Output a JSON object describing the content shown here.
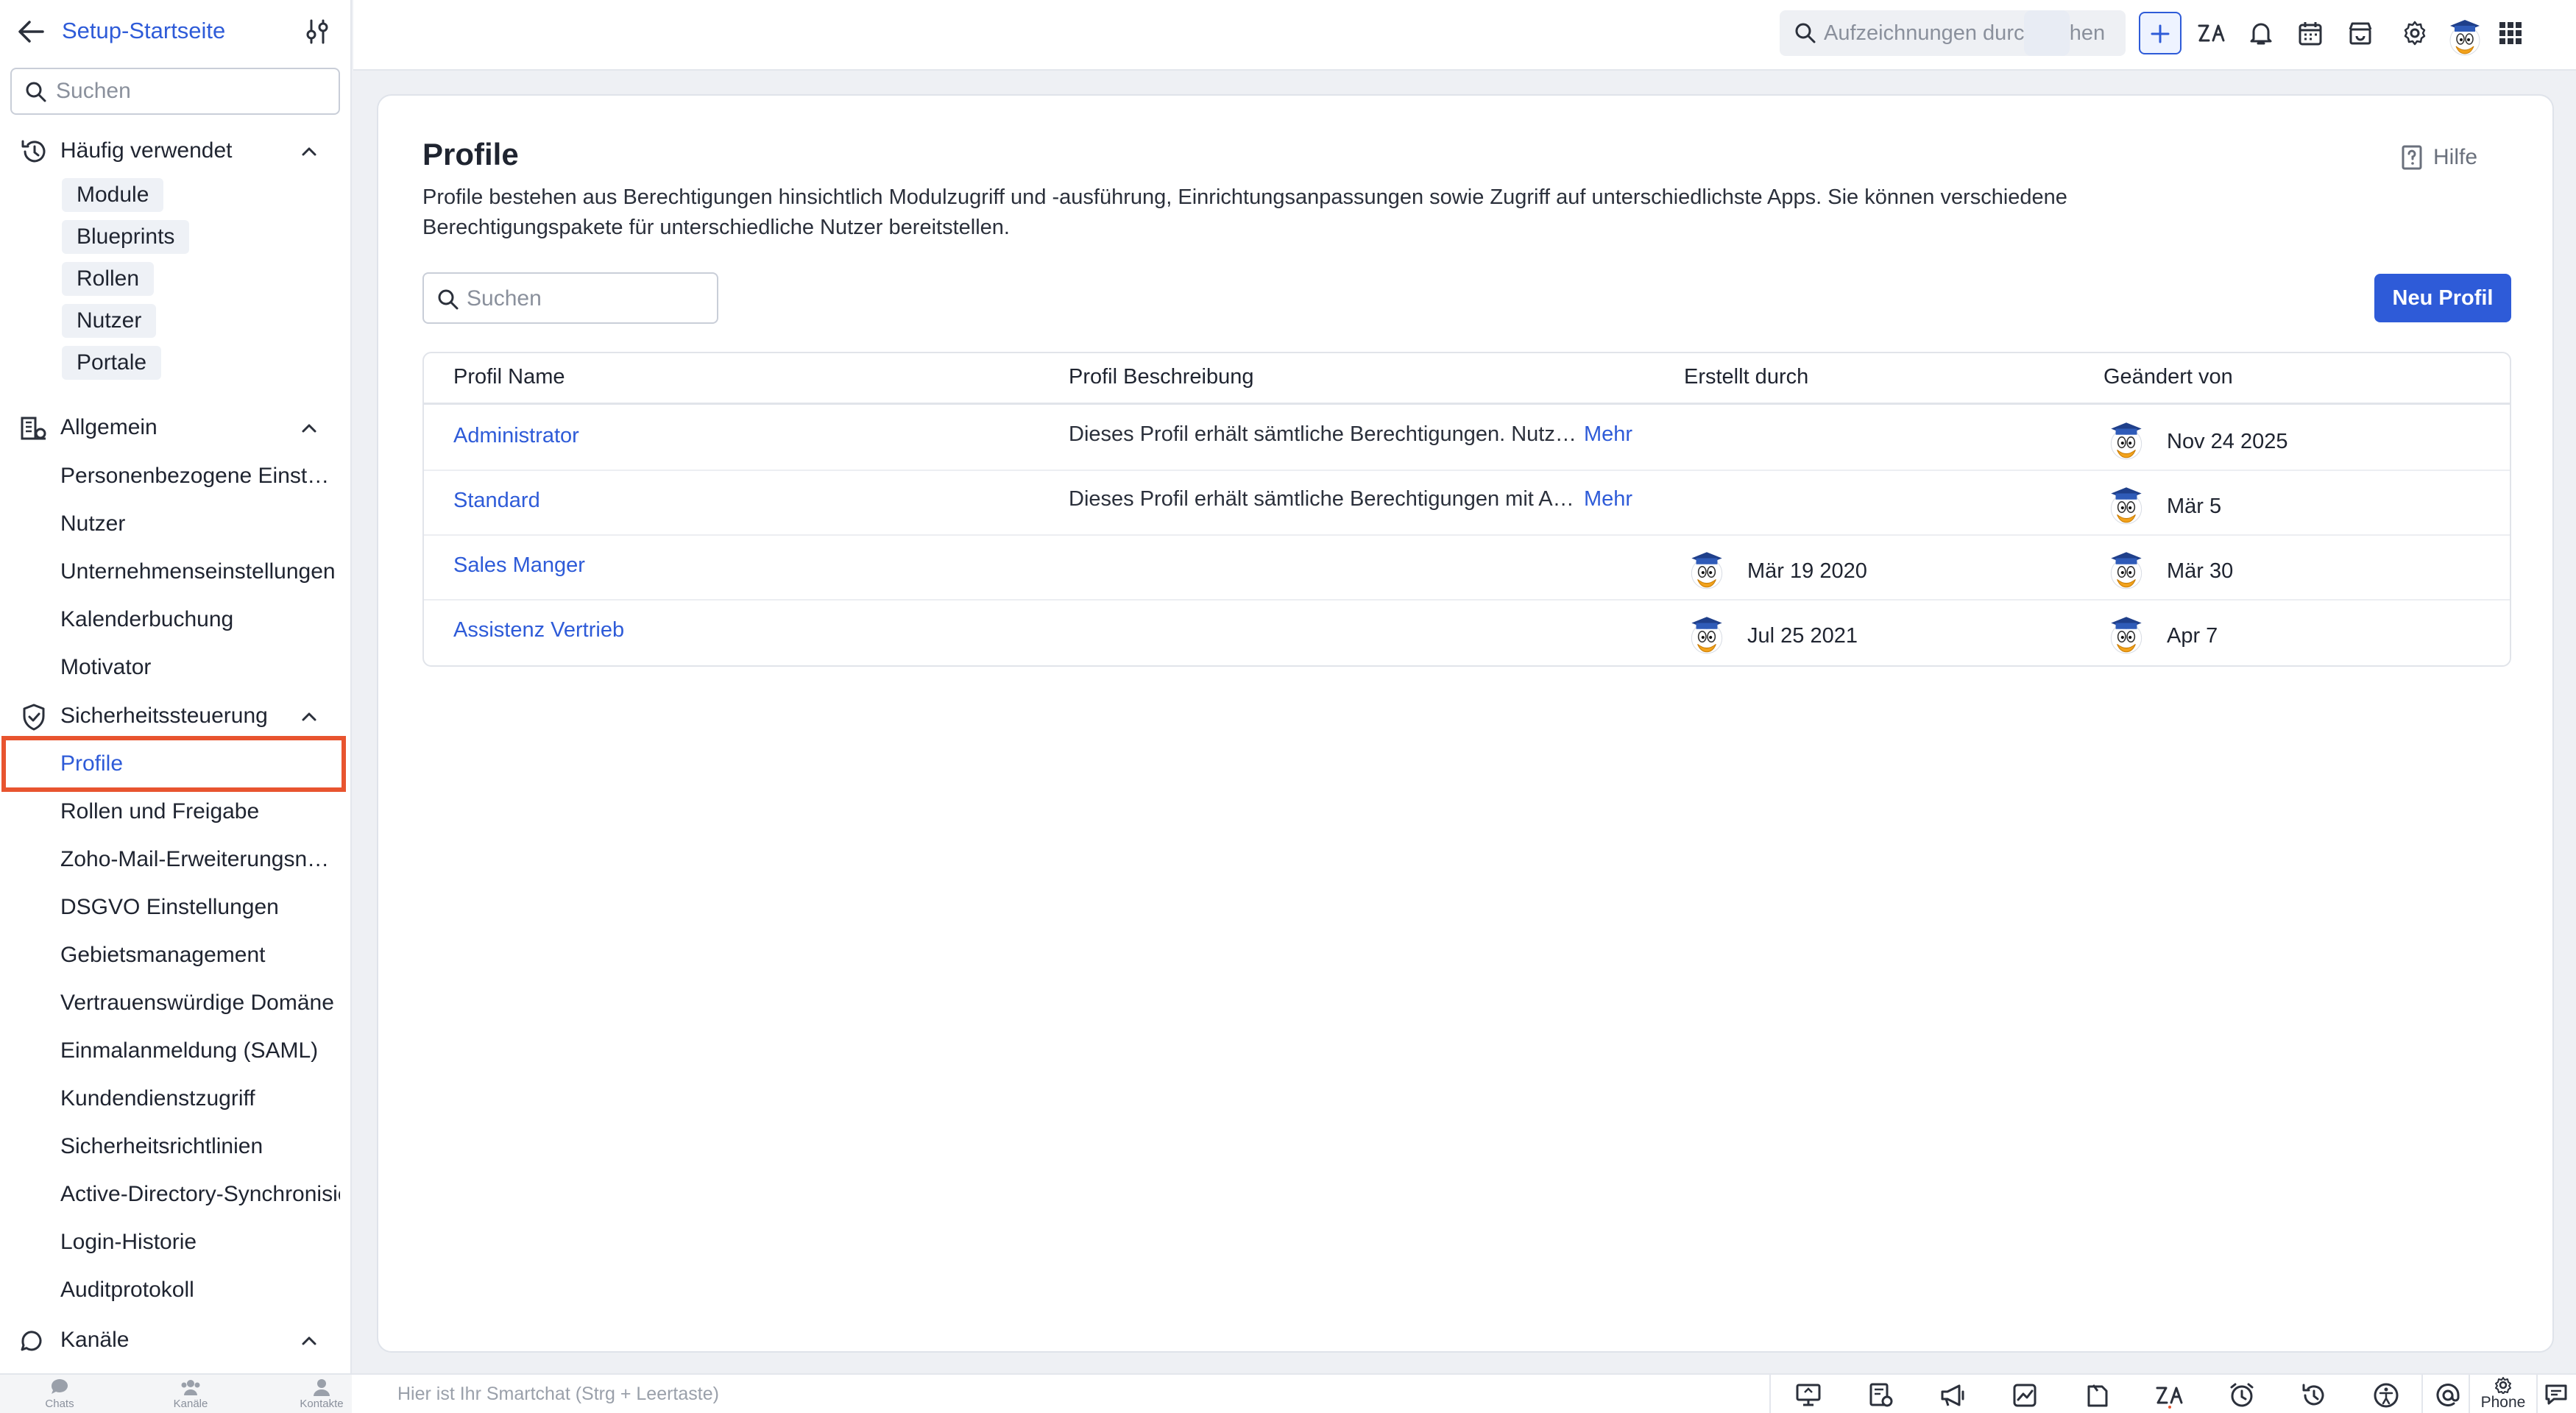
{
  "sidebar": {
    "title": "Setup-Startseite",
    "search_placeholder": "Suchen",
    "sections": {
      "frequent": {
        "label": "Häufig verwendet",
        "chips": [
          "Module",
          "Blueprints",
          "Rollen",
          "Nutzer",
          "Portale"
        ]
      },
      "general": {
        "label": "Allgemein",
        "items": [
          "Personenbezogene Einstellungen",
          "Nutzer",
          "Unternehmenseinstellungen",
          "Kalenderbuchung",
          "Motivator"
        ]
      },
      "security": {
        "label": "Sicherheitssteuerung",
        "items": [
          "Profile",
          "Rollen und Freigabe",
          "Zoho-Mail-Erweiterungsnutzer",
          "DSGVO Einstellungen",
          "Gebietsmanagement",
          "Vertrauenswürdige Domäne",
          "Einmalanmeldung (SAML)",
          "Kundendienstzugriff",
          "Sicherheitsrichtlinien",
          "Active-Directory-Synchronisierung",
          "Login-Historie",
          "Auditprotokoll"
        ]
      },
      "channels": {
        "label": "Kanäle"
      }
    }
  },
  "topbar": {
    "search_placeholder": "Aufzeichnungen durchsuchen"
  },
  "main": {
    "title": "Profile",
    "help_label": "Hilfe",
    "description": "Profile bestehen aus Berechtigungen hinsichtlich Modulzugriff und -ausführung, Einrichtungsanpassungen sowie Zugriff auf unterschiedlichste Apps. Sie können verschiedene Berechtigungspakete für unterschiedliche Nutzer bereitstellen.",
    "search_placeholder": "Suchen",
    "new_button": "Neu Profil",
    "columns": [
      "Profil Name",
      "Profil Beschreibung",
      "Erstellt durch",
      "Geändert von"
    ],
    "rows": [
      {
        "name": "Administrator",
        "description": "Dieses Profil erhält sämtliche Berechtigungen. Nutzer mit Administratorprofil können alle Daten anzeigen und verwalten.",
        "more": "Mehr",
        "created": "",
        "modified": "Nov 24 2025"
      },
      {
        "name": "Standard",
        "description": "Dieses Profil erhält sämtliche Berechtigungen mit Ausnahme der Administratorrechte.",
        "more": "Mehr",
        "created": "",
        "modified": "Mär 5"
      },
      {
        "name": "Sales Manger",
        "description": "",
        "more": "",
        "created": "Mär 19 2020",
        "modified": "Mär 30"
      },
      {
        "name": "Assistenz Vertrieb",
        "description": "",
        "more": "",
        "created": "Jul 25 2021",
        "modified": "Apr 7"
      }
    ]
  },
  "bottombar": {
    "tabs": [
      "Chats",
      "Kanäle",
      "Kontakte"
    ],
    "smartchat_placeholder": "Hier ist Ihr Smartchat (Strg + Leertaste)",
    "phone_label": "Phone"
  },
  "colors": {
    "accent": "#2e5bd8",
    "highlight_border": "#e8542f"
  }
}
